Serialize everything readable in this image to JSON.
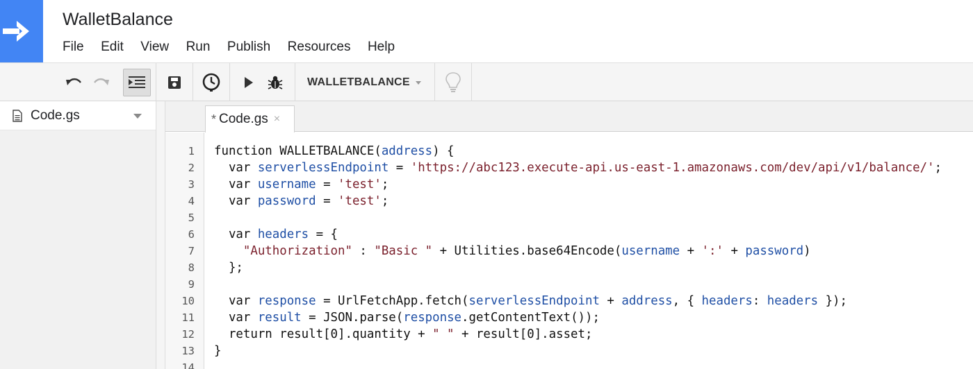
{
  "app": {
    "title": "WalletBalance",
    "menu": [
      "File",
      "Edit",
      "View",
      "Run",
      "Publish",
      "Resources",
      "Help"
    ]
  },
  "toolbar": {
    "function_select": "WALLETBALANCE",
    "icons": [
      "undo-icon",
      "redo-icon",
      "indent-icon",
      "save-icon",
      "triggers-icon",
      "run-icon",
      "debug-icon",
      "lightbulb-icon"
    ]
  },
  "files": [
    {
      "name": "Code.gs"
    }
  ],
  "editor": {
    "tab": {
      "modified_mark": "*",
      "label": "Code.gs",
      "close": "×"
    },
    "line_numbers": [
      "1",
      "2",
      "3",
      "4",
      "5",
      "6",
      "7",
      "8",
      "9",
      "10",
      "11",
      "12",
      "13",
      "14"
    ],
    "lines": [
      [
        [
          "kw",
          "function WALLETBALANCE("
        ],
        [
          "var",
          "address"
        ],
        [
          "kw",
          ") {"
        ]
      ],
      [
        [
          "kw",
          "  var "
        ],
        [
          "var",
          "serverlessEndpoint"
        ],
        [
          "kw",
          " = "
        ],
        [
          "str",
          "'https://abc123.execute-api.us-east-1.amazonaws.com/dev/api/v1/balance/'"
        ],
        [
          "kw",
          ";"
        ]
      ],
      [
        [
          "kw",
          "  var "
        ],
        [
          "var",
          "username"
        ],
        [
          "kw",
          " = "
        ],
        [
          "str",
          "'test'"
        ],
        [
          "kw",
          ";"
        ]
      ],
      [
        [
          "kw",
          "  var "
        ],
        [
          "var",
          "password"
        ],
        [
          "kw",
          " = "
        ],
        [
          "str",
          "'test'"
        ],
        [
          "kw",
          ";"
        ]
      ],
      [],
      [
        [
          "kw",
          "  var "
        ],
        [
          "var",
          "headers"
        ],
        [
          "kw",
          " = {"
        ]
      ],
      [
        [
          "str",
          "    \"Authorization\""
        ],
        [
          "kw",
          " : "
        ],
        [
          "str",
          "\"Basic \""
        ],
        [
          "kw",
          " + Utilities.base64Encode("
        ],
        [
          "var",
          "username"
        ],
        [
          "kw",
          " + "
        ],
        [
          "str",
          "':'"
        ],
        [
          "kw",
          " + "
        ],
        [
          "var",
          "password"
        ],
        [
          "kw",
          ")"
        ]
      ],
      [
        [
          "kw",
          "  };"
        ]
      ],
      [],
      [
        [
          "kw",
          "  var "
        ],
        [
          "var",
          "response"
        ],
        [
          "kw",
          " = UrlFetchApp.fetch("
        ],
        [
          "var",
          "serverlessEndpoint"
        ],
        [
          "kw",
          " + "
        ],
        [
          "var",
          "address"
        ],
        [
          "kw",
          ", { "
        ],
        [
          "var",
          "headers"
        ],
        [
          "kw",
          ": "
        ],
        [
          "var",
          "headers"
        ],
        [
          "kw",
          " });"
        ]
      ],
      [
        [
          "kw",
          "  var "
        ],
        [
          "var",
          "result"
        ],
        [
          "kw",
          " = JSON.parse("
        ],
        [
          "var",
          "response"
        ],
        [
          "kw",
          ".getContentText());"
        ]
      ],
      [
        [
          "kw",
          "  return result[0].quantity + "
        ],
        [
          "str",
          "\" \""
        ],
        [
          "kw",
          " + result[0].asset;"
        ]
      ],
      [
        [
          "kw",
          "}"
        ]
      ],
      []
    ]
  },
  "colors": {
    "brand_blue": "#4285f4",
    "variable": "#1f4fa5",
    "string": "#7a1f2b"
  }
}
